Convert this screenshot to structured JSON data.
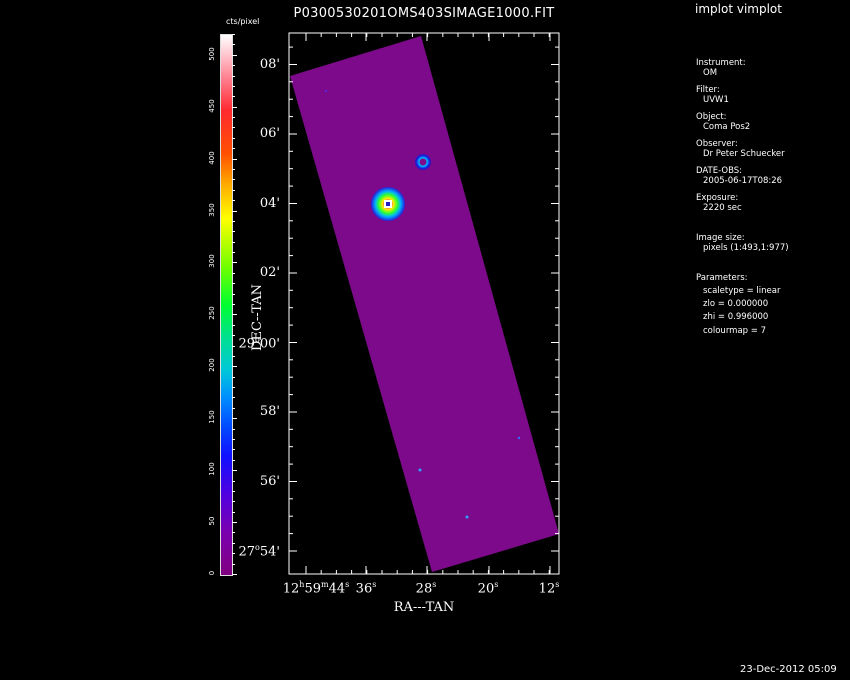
{
  "title": "P0300530201OMS403SIMAGE1000.FIT",
  "header_right": "implot vimplot",
  "colorbar": {
    "unit": "cts/pixel",
    "labels": [
      "0",
      "50",
      "100",
      "150",
      "200",
      "250",
      "300",
      "350",
      "400",
      "450",
      "500"
    ],
    "max_value": 520
  },
  "info_panel": {
    "instrument_label": "Instrument:",
    "instrument": "OM",
    "filter_label": "Filter:",
    "filter": "UVW1",
    "object_label": "Object:",
    "object": "Coma Pos2",
    "observer_label": "Observer:",
    "observer": "Dr Peter Schuecker",
    "date_label": "DATE-OBS:",
    "date": "2005-06-17T08:26",
    "exposure_label": "Exposure:",
    "exposure": "2220 sec",
    "imgsize_label": "Image size:",
    "imgsize": "pixels (1:493,1:977)",
    "params_label": "Parameters:",
    "scaletype": "scaletype = linear",
    "zlo": "zlo = 0.000000",
    "zhi": "zhi = 0.996000",
    "colourmap": "colourmap =   7"
  },
  "axes": {
    "x_title": "RA---TAN",
    "y_title": "DEC--TAN",
    "x_ticks": {
      "first_h": "12",
      "first_m": "59",
      "first_s": "44",
      "others": [
        "36",
        "28",
        "20",
        "12"
      ]
    },
    "y_ticks": {
      "first_deg": "27",
      "first_min": "54",
      "mid_deg": "29",
      "mid_min": "00",
      "others": [
        "56'",
        "58'",
        "02'",
        "04'",
        "06'",
        "08'"
      ]
    }
  },
  "footer_date": "23-Dec-2012 05:09",
  "colors": {
    "background": "#000000",
    "field": "#7d0a8a",
    "frame": "#ffffff"
  }
}
